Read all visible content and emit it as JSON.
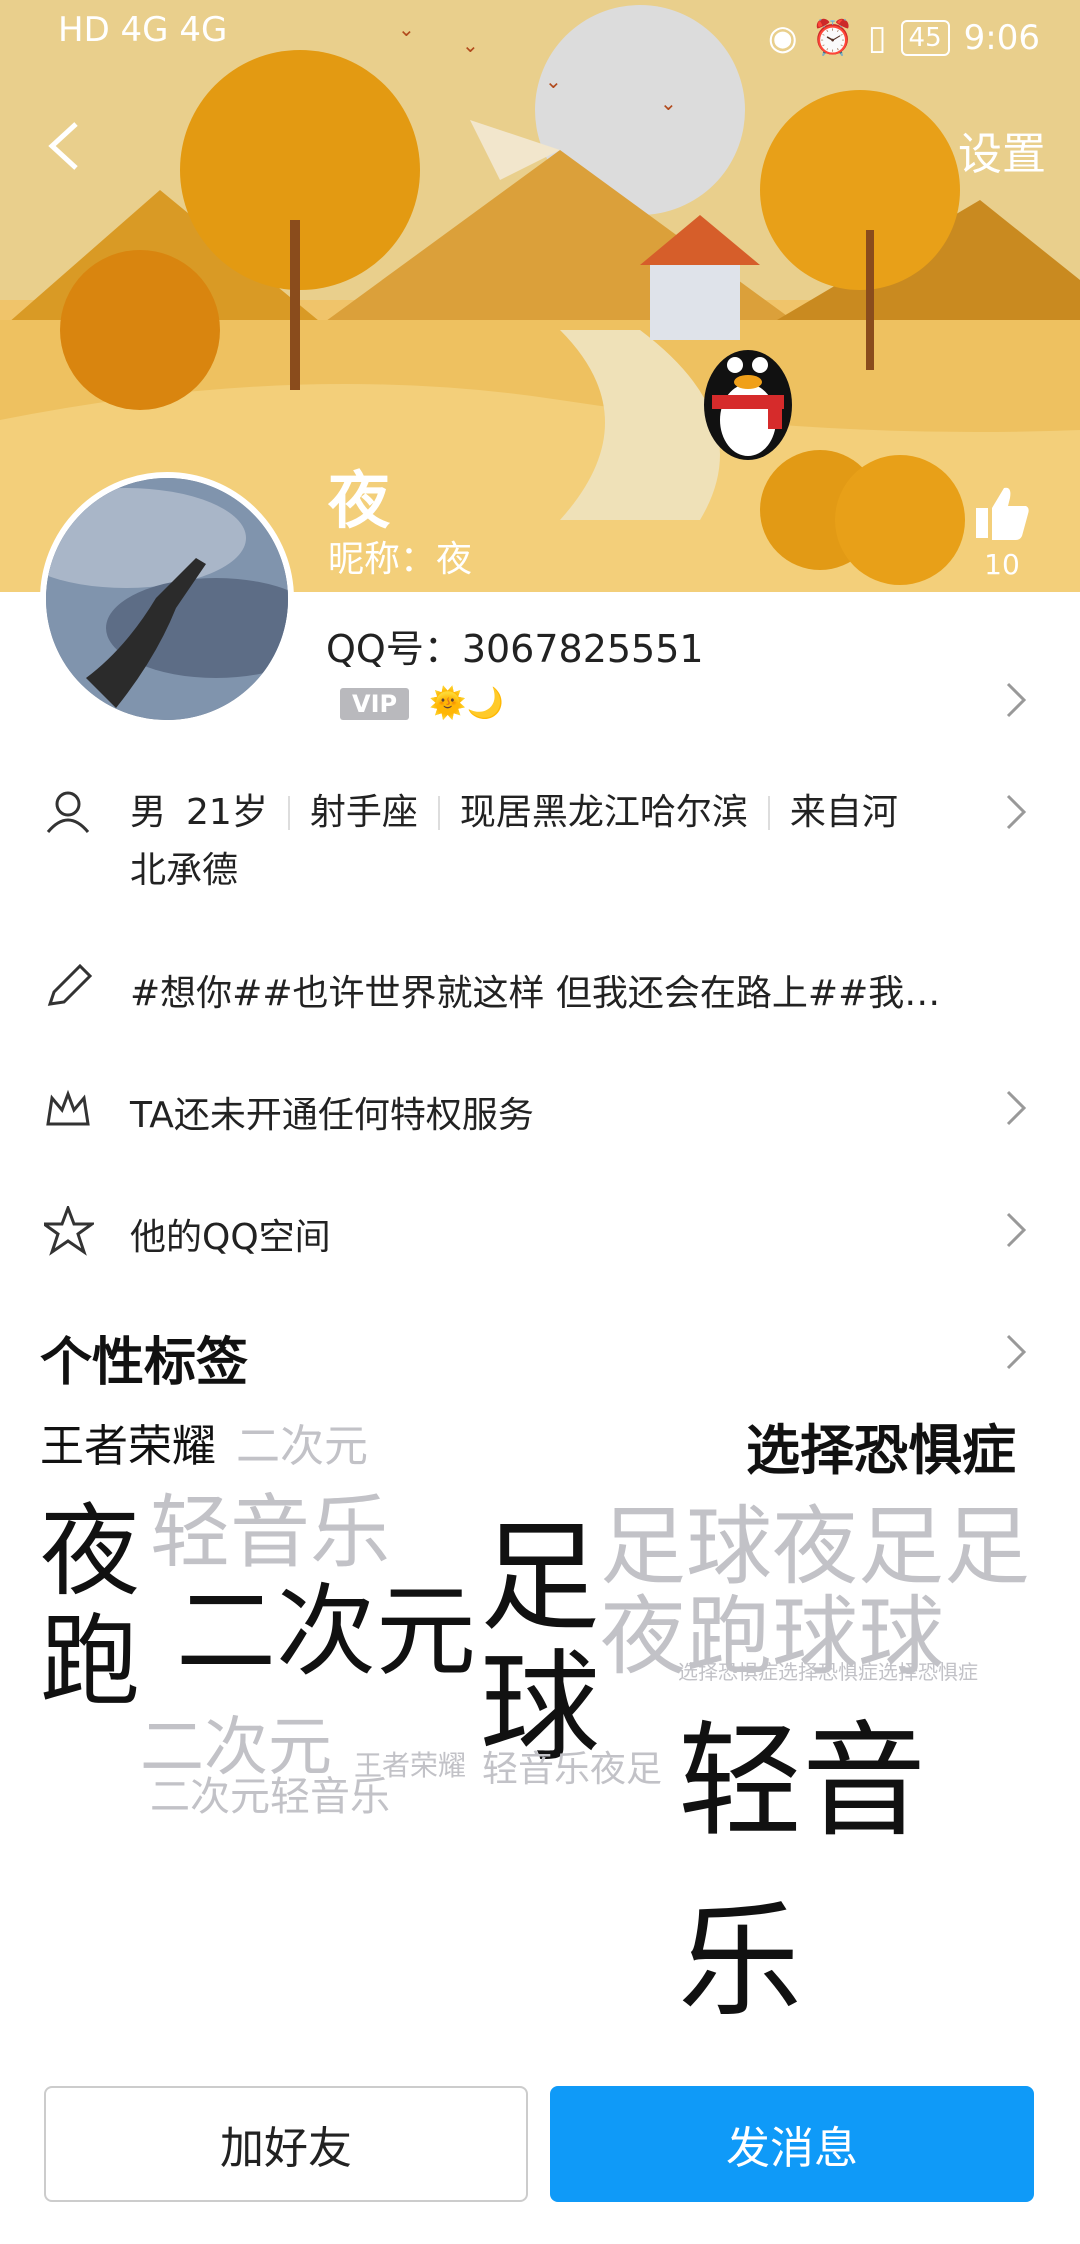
{
  "status_bar": {
    "left_text": "HD 4G 4G",
    "battery": "45",
    "time": "9:06"
  },
  "header": {
    "settings_label": "设置",
    "nickname_big": "夜",
    "nickname_line": "昵称：夜",
    "like_count": "10"
  },
  "profile": {
    "qq_number": "QQ号：3067825551",
    "vip_badge": "VIP",
    "level_icons": "🌞🌙"
  },
  "info": {
    "gender": "男",
    "age": "21岁",
    "zodiac": "射手座",
    "location": "现居黑龙江哈尔滨",
    "hometown_a": "来自河",
    "hometown_b": "北承德"
  },
  "signature": "#想你##也许世界就这样 但我还会在路上##我…",
  "privilege": "TA还未开通任何特权服务",
  "qzone": "他的QQ空间",
  "tags_section": {
    "title": "个性标签",
    "words": [
      {
        "text": "王者荣耀",
        "cls": "dark"
      },
      {
        "text": "二次元",
        "cls": "light"
      },
      {
        "text": "选择恐惧症",
        "cls": "dark"
      },
      {
        "text": "夜",
        "cls": "dark"
      },
      {
        "text": "跑",
        "cls": "dark"
      },
      {
        "text": "轻音乐",
        "cls": "light"
      },
      {
        "text": "二次元",
        "cls": "dark"
      },
      {
        "text": "足",
        "cls": "dark"
      },
      {
        "text": "球",
        "cls": "dark"
      },
      {
        "text": "足球夜足足",
        "cls": "light"
      },
      {
        "text": "夜跑球球",
        "cls": "light"
      },
      {
        "text": "轻音乐",
        "cls": "dark"
      },
      {
        "text": "二次元轻音乐",
        "cls": "light"
      },
      {
        "text": "二次元",
        "cls": "light"
      },
      {
        "text": "王者荣耀",
        "cls": "light"
      },
      {
        "text": "轻音乐夜足",
        "cls": "light"
      },
      {
        "text": "选择恐惧症选择恐惧症选择恐惧症",
        "cls": "light"
      }
    ]
  },
  "buttons": {
    "add_friend": "加好友",
    "send_message": "发消息"
  }
}
